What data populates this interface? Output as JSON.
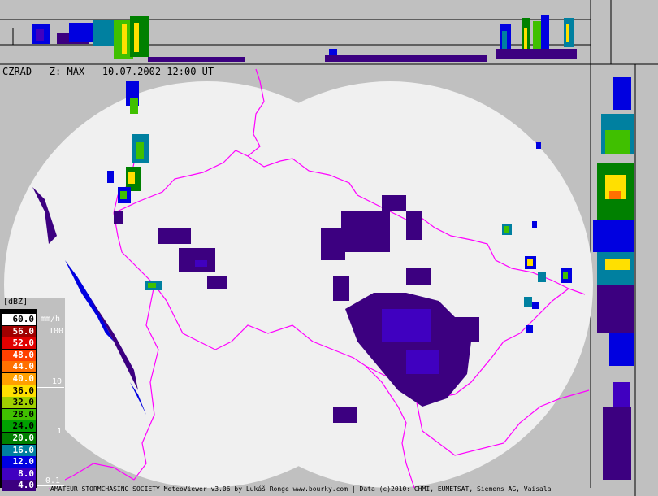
{
  "title": "CZRAD - Z: MAX - 10.07.2002 12:00 UT",
  "legend": {
    "header": "[dBZ]",
    "rate_unit": "mm/h",
    "rate_labels": [
      "100",
      "10",
      "1",
      "0.1"
    ],
    "entries": [
      {
        "label": "60.0",
        "color": "#ffffff",
        "text": "#000000"
      },
      {
        "label": "56.0",
        "color": "#a00000",
        "text": "#ffffff"
      },
      {
        "label": "52.0",
        "color": "#e00000",
        "text": "#ffffff"
      },
      {
        "label": "48.0",
        "color": "#ff4000",
        "text": "#ffffff"
      },
      {
        "label": "44.0",
        "color": "#ff7000",
        "text": "#ffffff"
      },
      {
        "label": "40.0",
        "color": "#ffa000",
        "text": "#ffffff"
      },
      {
        "label": "36.0",
        "color": "#ffe000",
        "text": "#000000"
      },
      {
        "label": "32.0",
        "color": "#a0d000",
        "text": "#000000"
      },
      {
        "label": "28.0",
        "color": "#40c000",
        "text": "#000000"
      },
      {
        "label": "24.0",
        "color": "#00a000",
        "text": "#000000"
      },
      {
        "label": "20.0",
        "color": "#008000",
        "text": "#ffffff"
      },
      {
        "label": "16.0",
        "color": "#0080a0",
        "text": "#ffffff"
      },
      {
        "label": "12.0",
        "color": "#0000e0",
        "text": "#ffffff"
      },
      {
        "label": "8.0",
        "color": "#4000c0",
        "text": "#ffffff"
      },
      {
        "label": "4.0",
        "color": "#3c0080",
        "text": "#ffffff"
      }
    ]
  },
  "credits": "AMATEUR STORMCHASING SOCIETY MeteoViewer v3.06 by Lukáš Ronge www.bourky.com | Data (c)2010: CHMI, EUMETSAT, Siemens AG, Vaisala",
  "colors": {
    "background": "#c0c0c0",
    "radar_area": "#f0f0f0",
    "border": "#ff00ff",
    "echo_weak": "#3c0080",
    "echo_mid": "#0000e0",
    "echo_green": "#40c000",
    "echo_yellow": "#ffe000"
  }
}
